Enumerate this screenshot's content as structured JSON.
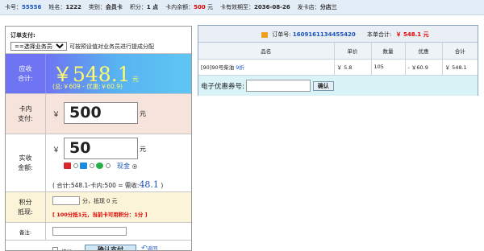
{
  "infobar": {
    "items": [
      {
        "label": "卡号：",
        "value": "55556",
        "style": "blue"
      },
      {
        "label": "姓名：",
        "value": "1222",
        "style": "bold"
      },
      {
        "label": "类别：",
        "value": "会员卡",
        "style": "bold"
      },
      {
        "label": "积分：",
        "value": "1 点",
        "style": "bold"
      },
      {
        "label": "卡内余额：",
        "value": "500",
        "unit": " 元",
        "style": "red"
      },
      {
        "label": "卡有效期至：",
        "value": "2036-08-26",
        "style": "bold"
      },
      {
        "label": "发卡店：",
        "value": "分店三",
        "style": "bold"
      }
    ]
  },
  "order": {
    "title": "订单支付:",
    "staff_select": "==选择业务员==",
    "staff_hint": "可按预设值对业务员进行提成分配"
  },
  "due": {
    "label_line1": "应收",
    "label_line2": "合计:",
    "amount": "￥548.1",
    "unit": "元",
    "detail": "(总:￥609 - 优惠:￥60.9)"
  },
  "card_pay": {
    "label_line1": "卡内",
    "label_line2": "支付:",
    "currency": "￥",
    "value": "500",
    "unit": "元"
  },
  "cash_pay": {
    "label_line1": "实收",
    "label_line2": "金额:",
    "currency": "￥",
    "value": "50",
    "unit": "元",
    "methods": [
      {
        "icon": "unionpay-icon",
        "color": "#d8262c",
        "checked": false
      },
      {
        "icon": "alipay-icon",
        "color": "#1b8be0",
        "checked": false
      },
      {
        "icon": "wechat-pay-icon",
        "color": "#2aae47",
        "checked": false
      }
    ],
    "cash_label": "现金",
    "cash_checked": true,
    "formula": "( 合计:548.1-卡内:500 = 需收:",
    "formula_value": "48.1",
    "formula_end": ")"
  },
  "points": {
    "label_line1": "积分",
    "label_line2": "抵现:",
    "unit": "分",
    "deduct_label": "，抵现",
    "deduct_value": "0",
    "deduct_unit": "元",
    "rule": "[ 100分抵1元，当前卡可用积分：1分 ]"
  },
  "remark": {
    "label": "备注:"
  },
  "actions": {
    "print_label": "挂帐",
    "confirm_label": "确认支付",
    "back_label": "返回"
  },
  "right": {
    "order_no_label": "订单号:",
    "order_no": "1609161134455420",
    "total_label": "本单合计:",
    "total": "￥ 548.1 元",
    "columns": [
      "品名",
      "单价",
      "数量",
      "优惠",
      "合计"
    ],
    "rows": [
      {
        "name": "[90]90号柴油",
        "discount_tag": "9折",
        "price": "￥ 5.8",
        "qty": "105",
        "discount": "- ￥60.9",
        "total": "￥ 548.1"
      }
    ],
    "coupon_label": "电子优惠券号:",
    "coupon_button": "确认"
  }
}
